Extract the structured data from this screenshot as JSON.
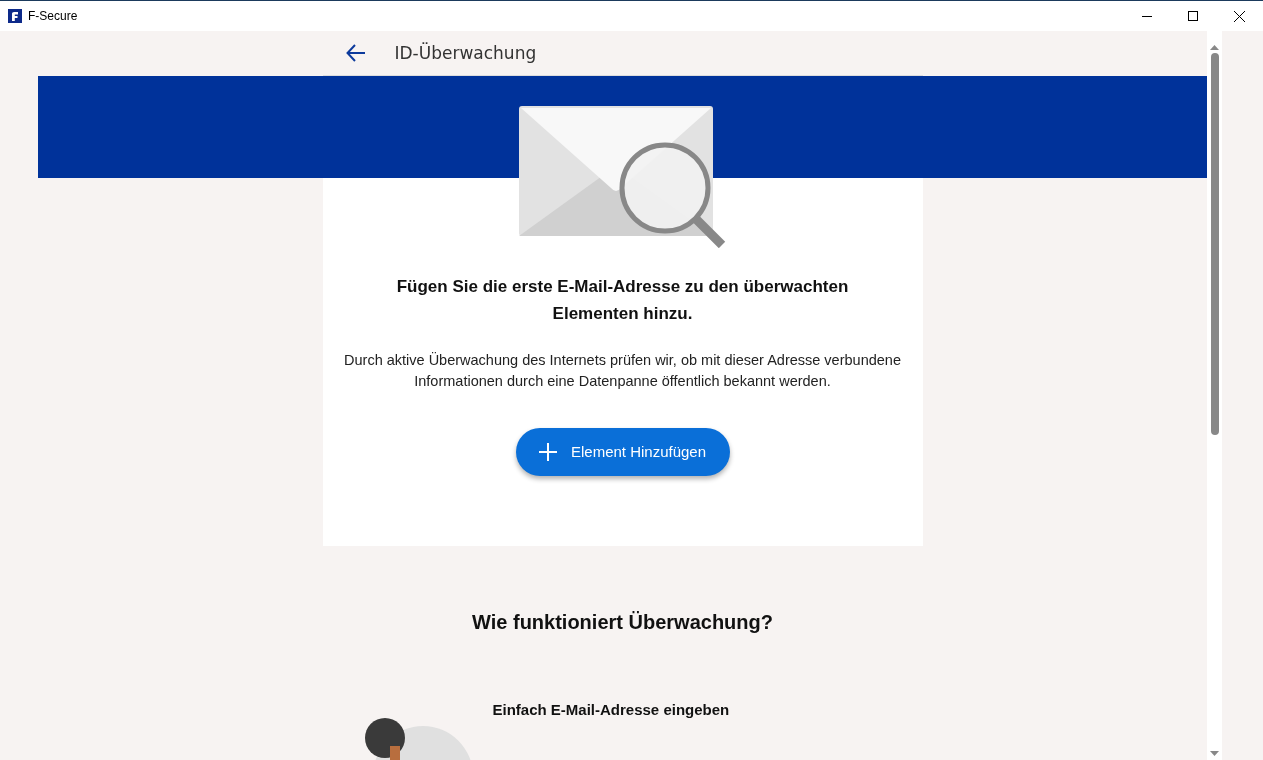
{
  "window": {
    "title": "F-Secure"
  },
  "header": {
    "title": "ID-Überwachung"
  },
  "card": {
    "heading": "Fügen Sie die erste E-Mail-Adresse zu den überwachten Elementen hinzu.",
    "text": "Durch aktive Überwachung des Internets prüfen wir, ob mit dieser Adresse verbundene Informationen durch eine Datenpanne öffentlich bekannt werden.",
    "button": "Element Hinzufügen"
  },
  "how": {
    "heading": "Wie funktioniert Überwachung?",
    "steps": [
      {
        "title": "Einfach E-Mail-Adresse eingeben"
      }
    ]
  }
}
